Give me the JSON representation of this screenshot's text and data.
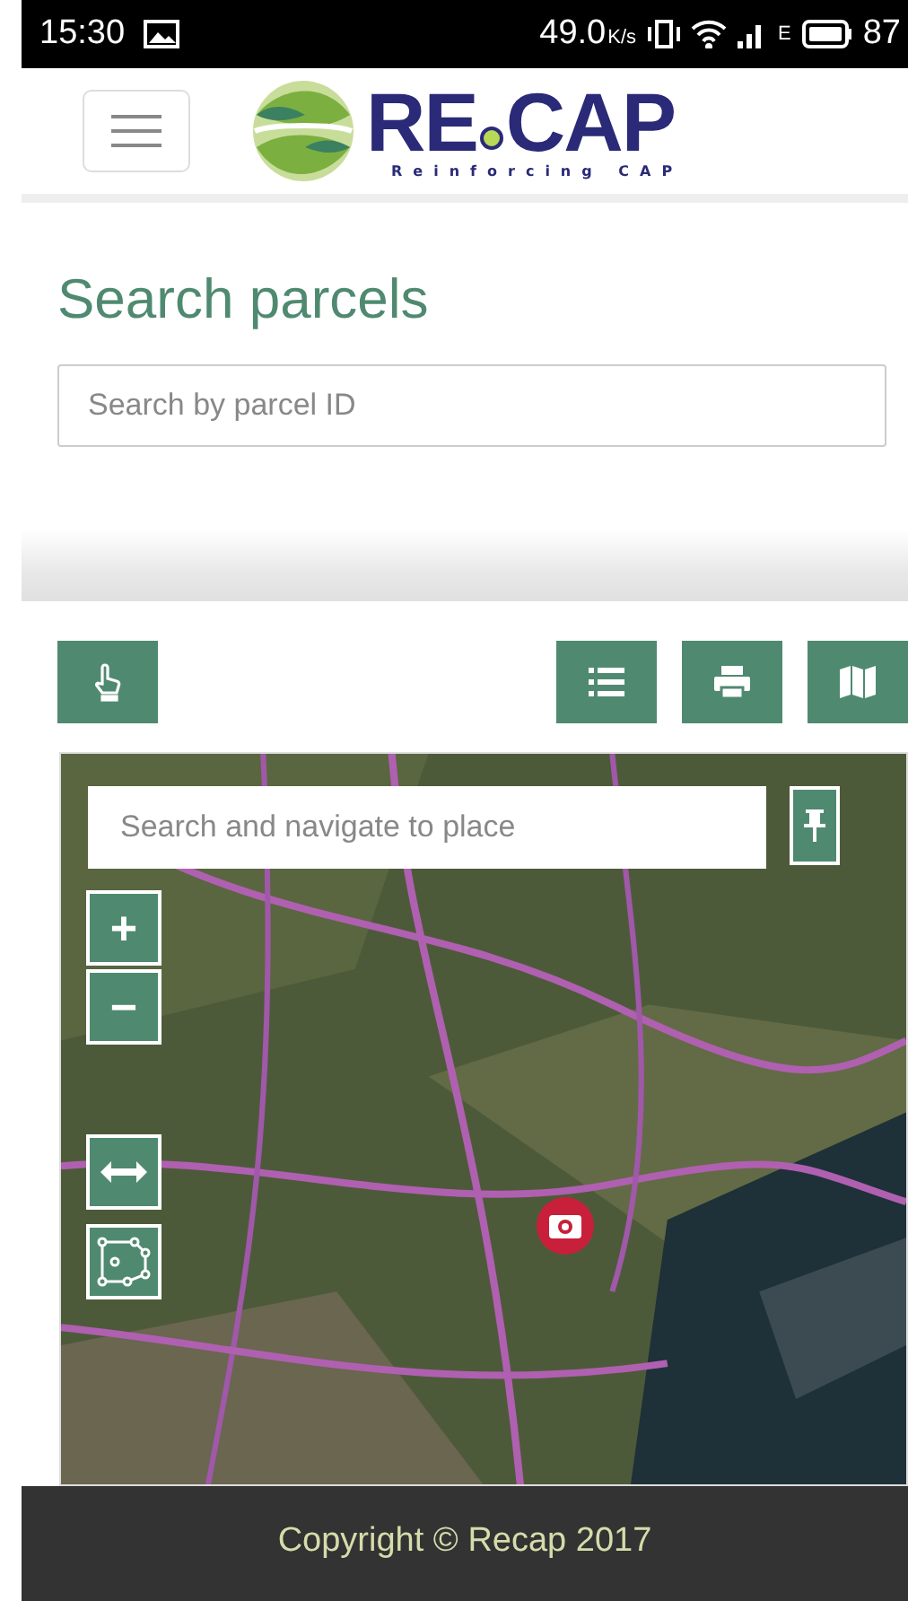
{
  "status_bar": {
    "time": "15:30",
    "speed": "49.0",
    "speed_unit": "K/s",
    "network_type": "E",
    "battery": "87"
  },
  "header": {
    "logo": {
      "first": "RE",
      "second": "CAP",
      "tagline": "Reinforcing CAP"
    }
  },
  "search_parcels": {
    "title": "Search parcels",
    "placeholder": "Search by parcel ID"
  },
  "map": {
    "kind": "picture",
    "search": {
      "placeholder": "Search and navigate to place"
    },
    "controls": [
      {
        "label": "+"
      },
      {
        "label": "−"
      }
    ]
  },
  "footer": {
    "copyright": "Copyright © Recap 2017"
  }
}
